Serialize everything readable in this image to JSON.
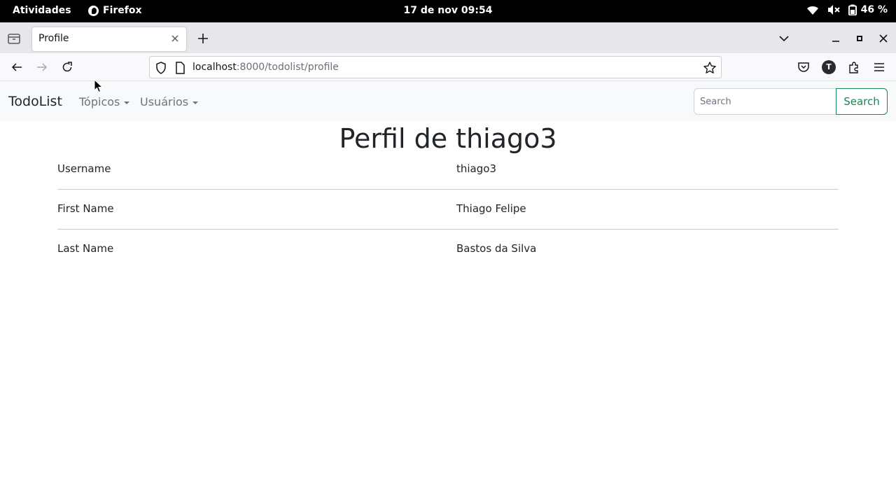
{
  "system_bar": {
    "activities": "Atividades",
    "app_name": "Firefox",
    "clock": "17 de nov  09:54",
    "battery": "46 %",
    "icons": [
      "wifi-icon",
      "volume-muted-icon",
      "battery-icon"
    ]
  },
  "browser": {
    "tab_title": "Profile",
    "url_host": "localhost",
    "url_rest": ":8000/todolist/profile",
    "toolbar_icons": [
      "back-icon",
      "forward-icon",
      "reload-icon",
      "pocket-icon",
      "account-icon",
      "extensions-icon",
      "menu-icon"
    ],
    "account_letter": "T"
  },
  "site_nav": {
    "brand": "TodoList",
    "menu": [
      {
        "label": "Tópicos"
      },
      {
        "label": "Usuários"
      }
    ],
    "search_placeholder": "Search",
    "search_button": "Search",
    "accent_color": "#198754"
  },
  "profile": {
    "title": "Perfil de thiago3",
    "rows": [
      {
        "label": "Username",
        "value": "thiago3"
      },
      {
        "label": "First Name",
        "value": "Thiago Felipe"
      },
      {
        "label": "Last Name",
        "value": "Bastos da Silva"
      }
    ]
  }
}
